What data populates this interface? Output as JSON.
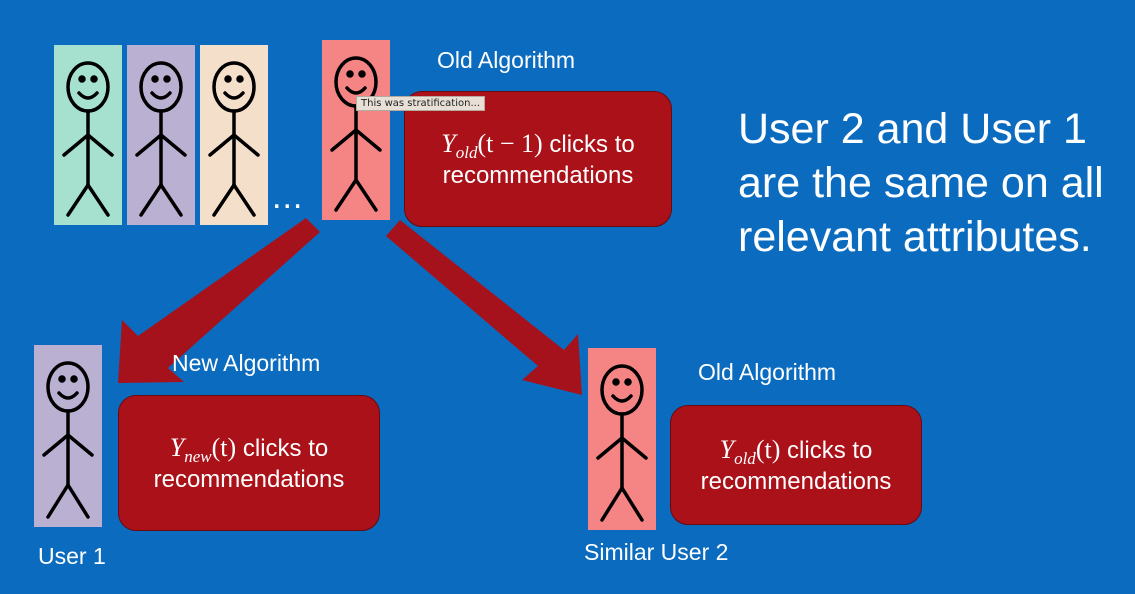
{
  "top": {
    "algorithm_label": "Old Algorithm",
    "ellipsis": "...",
    "tooltip": "This was stratification...",
    "box": {
      "symbol": "Y",
      "subscript": "old",
      "argument": "(t − 1)",
      "line1_suffix": " clicks to",
      "line2": "recommendations"
    }
  },
  "headline": {
    "line1": "User 2 and User 1",
    "line2": "are the same on all",
    "line3": "relevant attributes."
  },
  "left": {
    "algorithm_label": "New Algorithm",
    "user_label": "User 1",
    "box": {
      "symbol": "Y",
      "subscript": "new",
      "argument": "(t)",
      "line1_suffix": " clicks to",
      "line2": "recommendations"
    }
  },
  "right": {
    "algorithm_label": "Old Algorithm",
    "user_label": "Similar User 2",
    "box": {
      "symbol": "Y",
      "subscript": "old",
      "argument": "(t)",
      "line1_suffix": " clicks to",
      "line2": "recommendations"
    }
  },
  "colors": {
    "background": "#0b6bbf",
    "box_red": "#aa1119",
    "arrow_red": "#a5121b",
    "figure_teal": "#a6e0cf",
    "figure_lavender": "#bab0d1",
    "figure_peach": "#f3dfca",
    "figure_pink": "#f58585",
    "stroke": "#000000"
  }
}
